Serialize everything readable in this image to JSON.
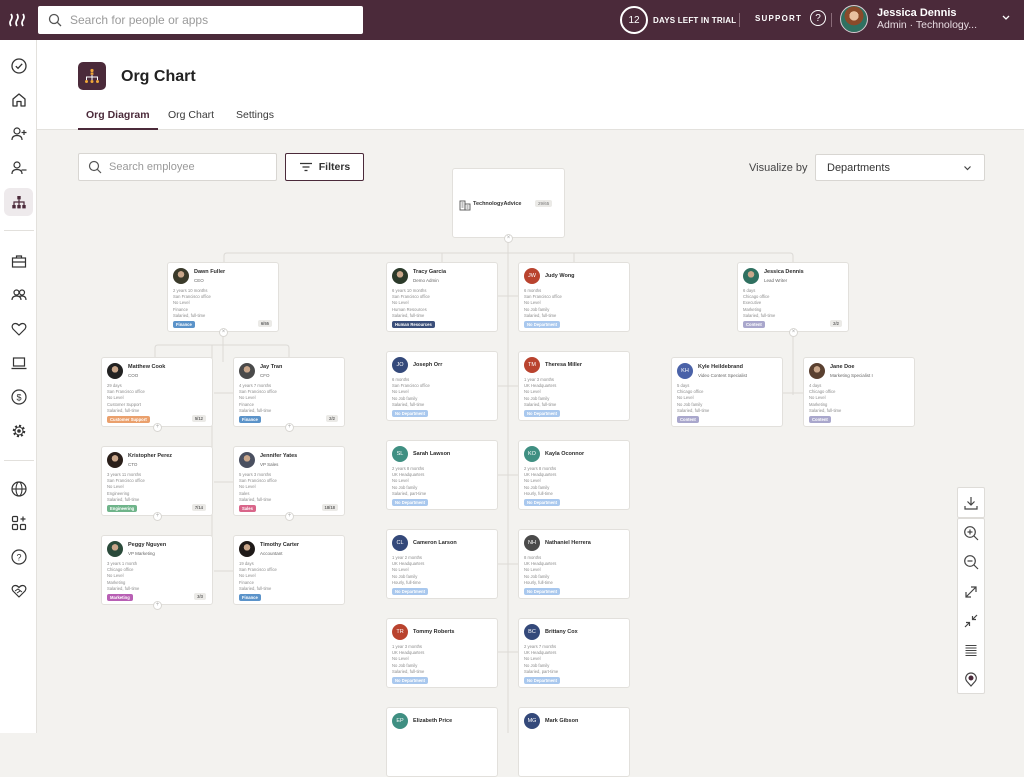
{
  "topbar": {
    "search_placeholder": "Search for people or apps",
    "trial_days": "12",
    "trial_text": "DAYS LEFT IN TRIAL",
    "support_label": "SUPPORT",
    "user_name": "Jessica Dennis",
    "user_role": "Admin · Technology..."
  },
  "sidebar": {
    "items": [
      {
        "icon": "check-circle-icon"
      },
      {
        "icon": "home-icon"
      },
      {
        "icon": "add-person-icon"
      },
      {
        "icon": "remove-person-icon"
      },
      {
        "icon": "org-chart-icon",
        "active": true
      },
      {
        "icon": "briefcase-icon"
      },
      {
        "icon": "people-icon"
      },
      {
        "icon": "heart-icon"
      },
      {
        "icon": "laptop-icon"
      },
      {
        "icon": "dollar-icon"
      },
      {
        "icon": "gear-icon"
      },
      {
        "icon": "globe-icon"
      },
      {
        "icon": "apps-add-icon"
      },
      {
        "icon": "help-icon"
      },
      {
        "icon": "handshake-icon"
      }
    ]
  },
  "header": {
    "title": "Org Chart",
    "tabs": [
      {
        "label": "Org Diagram",
        "active": true
      },
      {
        "label": "Org Chart",
        "active": false
      },
      {
        "label": "Settings",
        "active": false
      }
    ]
  },
  "toolbar": {
    "search_placeholder": "Search employee",
    "filters_label": "Filters",
    "visualize_label": "Visualize by",
    "visualize_value": "Departments"
  },
  "org": {
    "root": {
      "name": "TechnologyAdvice",
      "count": "29/65"
    },
    "cards": [
      {
        "id": "dawn",
        "name": "Dawn Fuller",
        "title": "CEO",
        "details": [
          "2 years 10 months",
          "San Francisco office",
          "No Level",
          "Finance",
          "Salaried, full-time"
        ],
        "dept": "Finance",
        "dept_color": "#5b93c9",
        "count": "6/55",
        "avatar": "photo",
        "avatar_color": "#3a3a2a"
      },
      {
        "id": "tracy",
        "name": "Tracy Garcia",
        "title": "Demo Admin",
        "details": [
          "6 years 10 months",
          "San Francisco office",
          "No Level",
          "Human Resources",
          "Salaried, full-time"
        ],
        "dept": "Human Resources",
        "dept_color": "#3b4f7a",
        "avatar": "photo",
        "avatar_color": "#2b3a2a"
      },
      {
        "id": "judy",
        "name": "Judy Wong",
        "initials": "JW",
        "details": [
          "6 months",
          "San Francisco office",
          "No Level",
          "No Job family",
          "Salaried, full-time"
        ],
        "dept": "No Department",
        "dept_color": "#a9c8ee",
        "avatar": "initials",
        "avatar_color": "#b9432e"
      },
      {
        "id": "jessica",
        "name": "Jessica Dennis",
        "title": "Lead Writer",
        "details": [
          "6 days",
          "Chicago office",
          "Executive",
          "Marketing",
          "Salaried, full-time"
        ],
        "dept": "Content",
        "dept_color": "#a9a7cc",
        "count": "2/2",
        "avatar": "photo",
        "avatar_color": "#2f7060"
      },
      {
        "id": "matthew",
        "name": "Matthew Cook",
        "title": "COO",
        "details": [
          "29 days",
          "San Francisco office",
          "No Level",
          "Customer Support",
          "Salaried, full-time"
        ],
        "dept": "Customer Support",
        "dept_color": "#eaa06c",
        "count": "5/12",
        "avatar": "photo",
        "avatar_color": "#222"
      },
      {
        "id": "jay",
        "name": "Jay Tran",
        "title": "CFO",
        "details": [
          "4 years 7 months",
          "San Francisco office",
          "No Level",
          "Finance",
          "Salaried, full-time"
        ],
        "dept": "Finance",
        "dept_color": "#5b93c9",
        "count": "2/2",
        "avatar": "photo",
        "avatar_color": "#4a4a4a"
      },
      {
        "id": "kristopher",
        "name": "Kristopher Perez",
        "title": "CTO",
        "details": [
          "3 years 11 months",
          "San Francisco office",
          "No Level",
          "Engineering",
          "Salaried, full-time"
        ],
        "dept": "Engineering",
        "dept_color": "#6fb48a",
        "count": "7/14",
        "avatar": "photo",
        "avatar_color": "#2a1f1a"
      },
      {
        "id": "jennifer",
        "name": "Jennifer Yates",
        "title": "VP Sales",
        "details": [
          "5 years 3 months",
          "San Francisco office",
          "No Level",
          "Sales",
          "Salaried, full-time"
        ],
        "dept": "Sales",
        "dept_color": "#d9668a",
        "count": "18/18",
        "avatar": "photo",
        "avatar_color": "#4a5060"
      },
      {
        "id": "peggy",
        "name": "Peggy Nguyen",
        "title": "VP Marketing",
        "details": [
          "3 years 1 month",
          "Chicago office",
          "No Level",
          "Marketing",
          "Salaried, full-time"
        ],
        "dept": "Marketing",
        "dept_color": "#b85fb4",
        "count": "3/3",
        "avatar": "photo",
        "avatar_color": "#2a4a3a"
      },
      {
        "id": "timothy",
        "name": "Timothy Carter",
        "title": "Accountant",
        "details": [
          "19 days",
          "San Francisco office",
          "No Level",
          "Finance",
          "Salaried, full-time"
        ],
        "dept": "Finance",
        "dept_color": "#5b93c9",
        "avatar": "photo",
        "avatar_color": "#1f1a18"
      },
      {
        "id": "joseph",
        "name": "Joseph Orr",
        "initials": "JO",
        "details": [
          "6 months",
          "San Francisco office",
          "No Level",
          "No Job family",
          "Salaried, full-time"
        ],
        "dept": "No Department",
        "dept_color": "#a9c8ee",
        "avatar": "initials",
        "avatar_color": "#34497a"
      },
      {
        "id": "theresa",
        "name": "Theresa Miller",
        "initials": "TM",
        "details": [
          "1 year 3 months",
          "UK Headquarters",
          "No Level",
          "No Job family",
          "Salaried, full-time"
        ],
        "dept": "No Department",
        "dept_color": "#a9c8ee",
        "avatar": "initials",
        "avatar_color": "#b9432e"
      },
      {
        "id": "sarah",
        "name": "Sarah Lawson",
        "initials": "SL",
        "details": [
          "2 years 8 months",
          "UK Headquarters",
          "No Level",
          "No Job family",
          "Salaried, part-time"
        ],
        "dept": "No Department",
        "dept_color": "#a9c8ee",
        "avatar": "initials",
        "avatar_color": "#3f8f82"
      },
      {
        "id": "kayla",
        "name": "Kayla Oconnor",
        "initials": "KO",
        "details": [
          "2 years 8 months",
          "UK Headquarters",
          "No Level",
          "No Job family",
          "Hourly, full-time"
        ],
        "dept": "No Department",
        "dept_color": "#a9c8ee",
        "avatar": "initials",
        "avatar_color": "#3f8f82"
      },
      {
        "id": "cameron",
        "name": "Cameron Larson",
        "initials": "CL",
        "details": [
          "1 year 2 months",
          "UK Headquarters",
          "No Level",
          "No Job family",
          "Hourly, full-time"
        ],
        "dept": "No Department",
        "dept_color": "#a9c8ee",
        "avatar": "initials",
        "avatar_color": "#34497a"
      },
      {
        "id": "nathaniel",
        "name": "Nathaniel Herrera",
        "initials": "NH",
        "details": [
          "8 months",
          "UK Headquarters",
          "No Level",
          "No Job family",
          "Hourly, full-time"
        ],
        "dept": "No Department",
        "dept_color": "#a9c8ee",
        "avatar": "initials",
        "avatar_color": "#4a4a4a"
      },
      {
        "id": "tommy",
        "name": "Tommy Roberts",
        "initials": "TR",
        "details": [
          "1 year 3 months",
          "UK Headquarters",
          "No Level",
          "No Job family",
          "Salaried, full-time"
        ],
        "dept": "No Department",
        "dept_color": "#a9c8ee",
        "avatar": "initials",
        "avatar_color": "#b9432e"
      },
      {
        "id": "brittany",
        "name": "Brittany Cox",
        "initials": "BC",
        "details": [
          "2 years 7 months",
          "UK Headquarters",
          "No Level",
          "No Job family",
          "Salaried, part-time"
        ],
        "dept": "No Department",
        "dept_color": "#a9c8ee",
        "avatar": "initials",
        "avatar_color": "#34497a"
      },
      {
        "id": "kyle",
        "name": "Kyle Heildebrand",
        "initials": "KH",
        "title": "Video Content Specialist",
        "details": [
          "5 days",
          "Chicago office",
          "No Level",
          "No Job family",
          "Salaried, full-time"
        ],
        "dept": "Content",
        "dept_color": "#a9a7cc",
        "avatar": "initials",
        "avatar_color": "#4a62a8"
      },
      {
        "id": "jane",
        "name": "Jane Doe",
        "title": "Marketing Specialist I",
        "details": [
          "4 days",
          "Chicago office",
          "No Level",
          "Marketing",
          "Salaried, full-time"
        ],
        "dept": "Content",
        "dept_color": "#a9a7cc",
        "avatar": "photo",
        "avatar_color": "#5a4030"
      },
      {
        "id": "elizabeth",
        "name": "Elizabeth Price",
        "initials": "EP",
        "details": [],
        "avatar": "initials",
        "avatar_color": "#3f8f82"
      },
      {
        "id": "mark",
        "name": "Mark Gibson",
        "initials": "MG",
        "details": [],
        "avatar": "initials",
        "avatar_color": "#34497a"
      }
    ]
  },
  "canvas_tools": [
    {
      "icon": "download-icon"
    },
    {
      "icon": "zoom-in-icon"
    },
    {
      "icon": "zoom-out-icon"
    },
    {
      "icon": "expand-icon"
    },
    {
      "icon": "collapse-icon"
    },
    {
      "icon": "list-lines-icon"
    },
    {
      "icon": "locate-pin-icon"
    }
  ]
}
